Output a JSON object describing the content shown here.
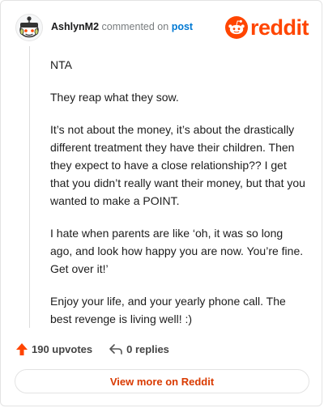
{
  "comment": {
    "username": "AshlynM2",
    "commented_on_text": "commented on",
    "post_link_text": "post",
    "paragraphs": [
      "NTA",
      "They reap what they sow.",
      "It’s not about the money, it’s about the drastically different treatment they have their children. Then they expect to have a close relationship?? I get that you didn’t really want their money, but that you wanted to make a POINT.",
      "I hate when parents are like ‘oh, it was so long ago, and look how happy you are now. You’re fine. Get over it!’",
      "Enjoy your life, and your yearly phone call. The best revenge is living well! :)"
    ]
  },
  "brand": {
    "wordmark": "reddit",
    "logo_icon": "reddit-snoo-icon",
    "color": "#ff4500"
  },
  "actions": {
    "upvotes_label": "190 upvotes",
    "upvote_icon": "upvote-arrow-icon",
    "upvote_color": "#ff4500",
    "replies_label": "0 replies",
    "reply_icon": "reply-arrow-icon"
  },
  "footer": {
    "view_more_label": "View more on Reddit"
  }
}
